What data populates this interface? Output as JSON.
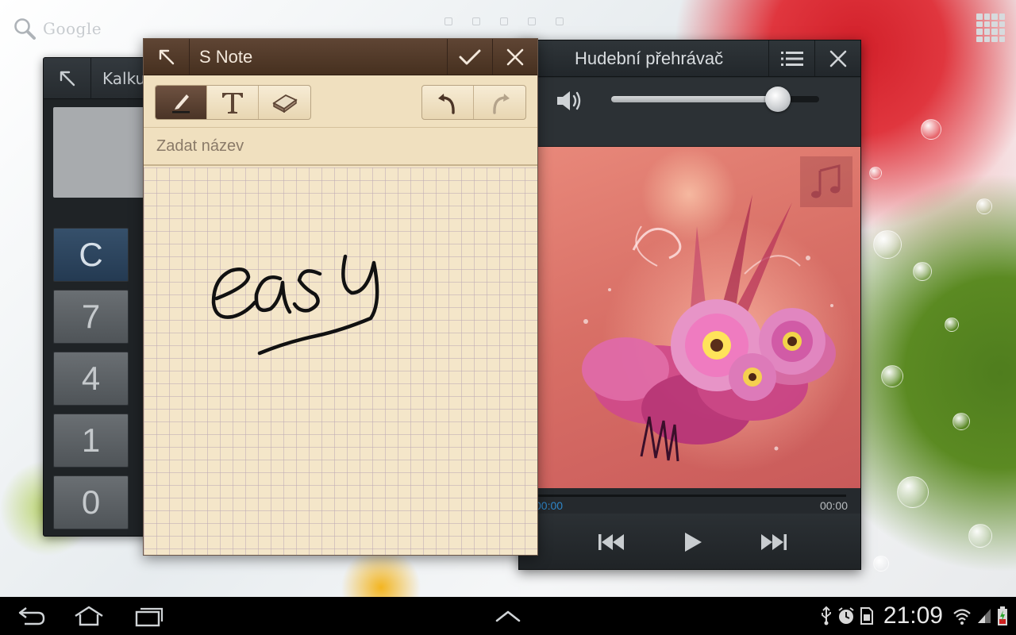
{
  "homescreen": {
    "search_label": "Google",
    "page_indicator_count": 5
  },
  "calculator": {
    "title": "Kalku",
    "keys": [
      {
        "label": "C"
      },
      {
        "label": "7"
      },
      {
        "label": "4"
      },
      {
        "label": "1"
      },
      {
        "label": "0"
      }
    ]
  },
  "snote": {
    "title": "S Note",
    "title_placeholder": "Zadat název",
    "tools": [
      "pen",
      "text",
      "eraser"
    ],
    "active_tool": "pen",
    "handwriting": "easy",
    "colors": {
      "header": "#4f3828",
      "paper": "#f4e6c9"
    }
  },
  "music": {
    "title": "Hudební přehrávač",
    "volume_level": 0.8,
    "elapsed": "00:00",
    "duration": "00:00",
    "playback_progress": 0,
    "colors": {
      "accent": "#2f86c8"
    }
  },
  "statusbar": {
    "time": "21:09"
  }
}
